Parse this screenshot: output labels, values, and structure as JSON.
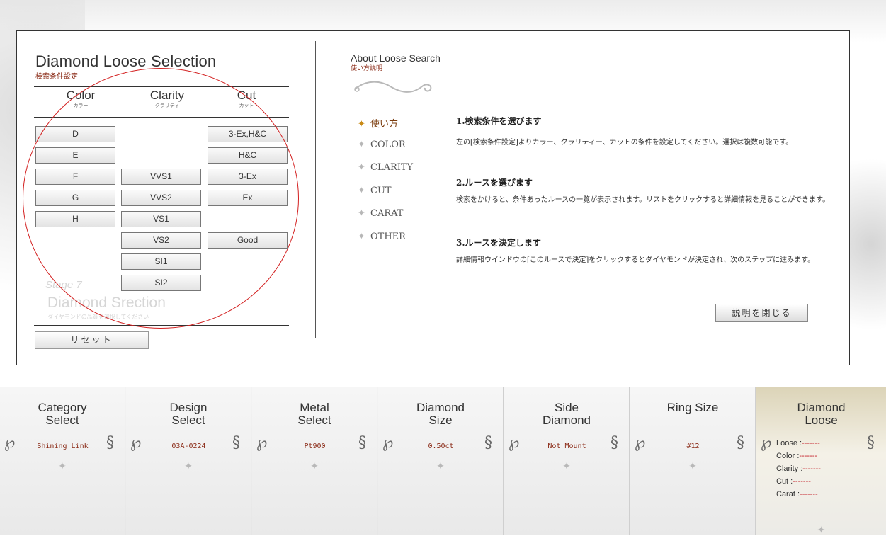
{
  "left_panel": {
    "title": "Diamond Loose Selection",
    "subtitle": "検索条件設定",
    "columns": [
      {
        "label": "Color",
        "sub": "カラー"
      },
      {
        "label": "Clarity",
        "sub": "クラリティ"
      },
      {
        "label": "Cut",
        "sub": "カット"
      }
    ],
    "color_options": [
      "D",
      "E",
      "F",
      "G",
      "H"
    ],
    "clarity_options": [
      "VVS1",
      "VVS2",
      "VS1",
      "VS2",
      "SI1",
      "SI2"
    ],
    "cut_options": [
      "3-Ex,H&C",
      "H&C",
      "3-Ex",
      "Ex",
      "Good"
    ],
    "ghost_stage": "Stage 7",
    "ghost_title": "Diamond Srection",
    "ghost_sub": "ダイヤモンドの品質を選択してください",
    "reset_label": "リセット"
  },
  "right_panel": {
    "title": "About Loose Search",
    "subtitle": "使い方説明",
    "nav": [
      {
        "label": "使い方",
        "active": true
      },
      {
        "label": "COLOR",
        "active": false
      },
      {
        "label": "CLARITY",
        "active": false
      },
      {
        "label": "CUT",
        "active": false
      },
      {
        "label": "CARAT",
        "active": false
      },
      {
        "label": "OTHER",
        "active": false
      }
    ],
    "steps": [
      {
        "heading": "1.検索条件を選びます",
        "body": "左の[検索条件設定]よりカラー、クラリティー、カットの条件を設定してください。選択は複数可能です。"
      },
      {
        "heading": "2.ルースを選びます",
        "body": "検索をかけると、条件あったルースの一覧が表示されます。リストをクリックすると詳細情報を見ることができます。"
      },
      {
        "heading": "3.ルースを決定します",
        "body": "詳細情報ウインドウの[このルースで決定]をクリックするとダイヤモンドが決定され、次のステップに進みます。"
      }
    ],
    "close_label": "説明を閉じる"
  },
  "bottom_steps": [
    {
      "title_line1": "Category",
      "title_line2": "Select",
      "value": "Shining Link"
    },
    {
      "title_line1": "Design",
      "title_line2": "Select",
      "value": "03A-0224"
    },
    {
      "title_line1": "Metal",
      "title_line2": "Select",
      "value": "Pt900"
    },
    {
      "title_line1": "Diamond",
      "title_line2": "Size",
      "value": "0.50ct"
    },
    {
      "title_line1": "Side",
      "title_line2": "Diamond",
      "value": "Not Mount"
    },
    {
      "title_line1": "Ring Size",
      "title_line2": "",
      "value": "#12"
    },
    {
      "title_line1": "Diamond",
      "title_line2": "Loose",
      "value": ""
    }
  ],
  "loose_summary": [
    {
      "label": "Loose",
      "value": "-------"
    },
    {
      "label": "Color",
      "value": "-------"
    },
    {
      "label": "Clarity",
      "value": "-------"
    },
    {
      "label": "Cut",
      "value": "-------"
    },
    {
      "label": "Carat",
      "value": "-------"
    }
  ],
  "colors": {
    "accent_red": "#8a2a16",
    "annotation_circle": "#d32020",
    "active_star": "#c98a16"
  }
}
